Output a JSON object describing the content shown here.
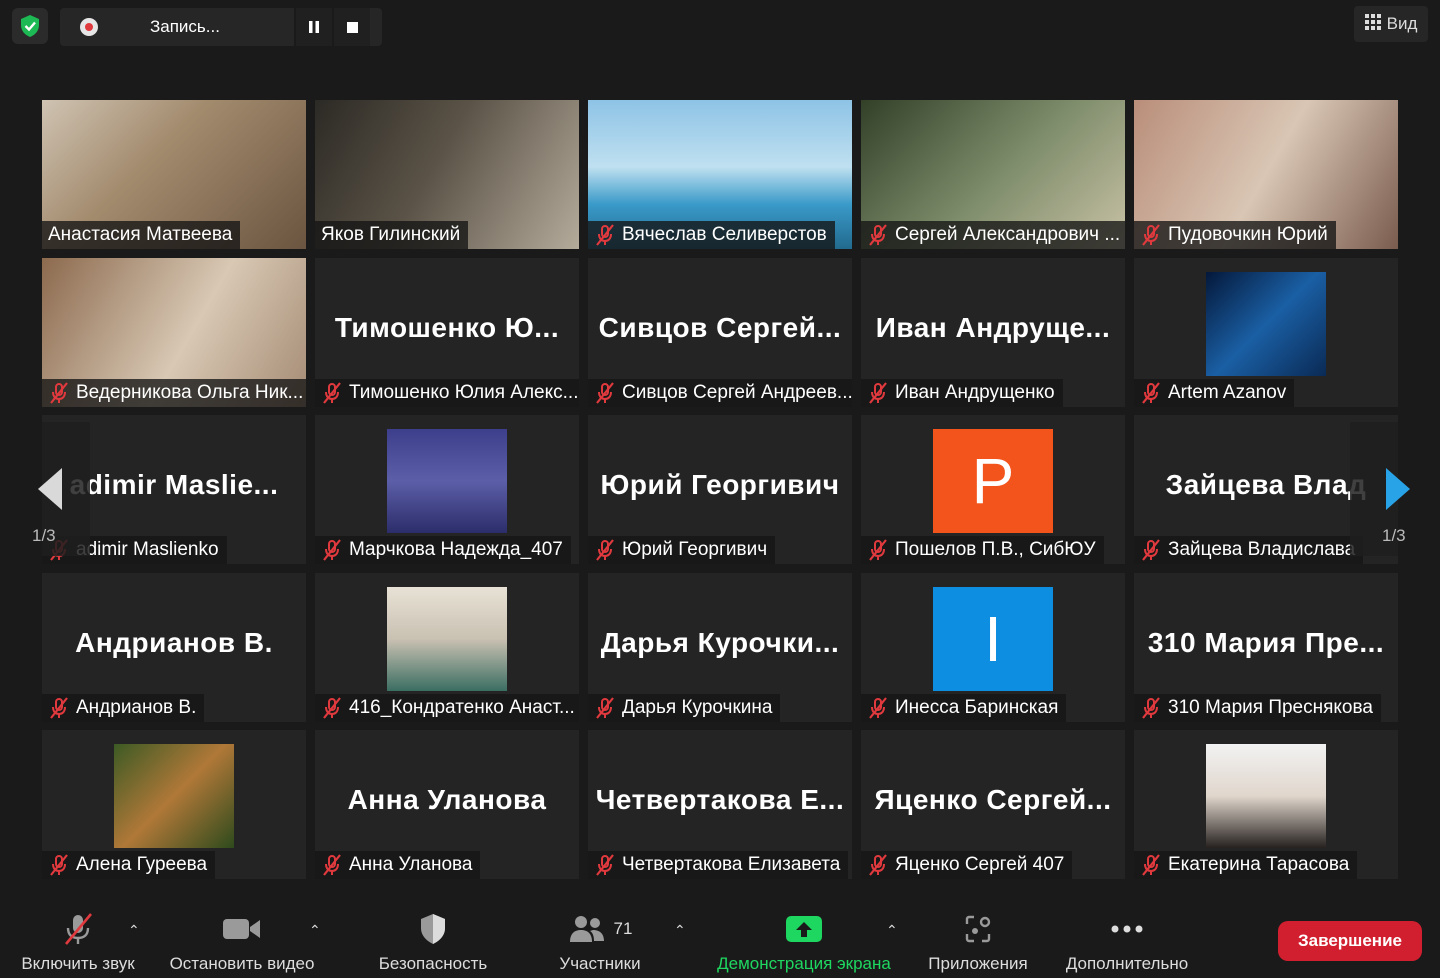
{
  "top_bar": {
    "recording_label": "Запись...",
    "view_label": "Вид"
  },
  "pagination": {
    "left": "1/3",
    "right": "1/3"
  },
  "participants": [
    {
      "label": "Анастасия Матвеева",
      "big": ""
    },
    {
      "label": "Яков Гилинский",
      "big": ""
    },
    {
      "label": "Вячеслав Селиверстов",
      "big": ""
    },
    {
      "label": "Сергей Александрович ...",
      "big": ""
    },
    {
      "label": "Пудовочкин Юрий",
      "big": ""
    },
    {
      "label": "Ведерникова Ольга Ник...",
      "big": ""
    },
    {
      "label": "Тимошенко Юлия Алекс...",
      "big": "Тимошенко  Ю..."
    },
    {
      "label": "Сивцов Сергей Андреев...",
      "big": "Сивцов  Сергей..."
    },
    {
      "label": "Иван Андрущенко",
      "big": "Иван  Андруще..."
    },
    {
      "label": "Artem Azanov",
      "big": ""
    },
    {
      "label": "adimir Maslienko",
      "big": "adimir  Maslie..."
    },
    {
      "label": "Марчкова Надежда_407",
      "big": ""
    },
    {
      "label": "Юрий Георгивич",
      "big": "Юрий Георгивич"
    },
    {
      "label": "Пошелов П.В., СибЮУ",
      "big": "",
      "avatar_letter": "P"
    },
    {
      "label": "Зайцева Владислава",
      "big": "Зайцева  Влад"
    },
    {
      "label": "Андрианов В.",
      "big": "Андрианов В."
    },
    {
      "label": "416_Кондратенко Анаст...",
      "big": ""
    },
    {
      "label": "Дарья Курочкина",
      "big": "Дарья  Курочки..."
    },
    {
      "label": "Инесса Баринская",
      "big": "",
      "avatar_letter": "I"
    },
    {
      "label": "310 Мария Преснякова",
      "big": "310  Мария  Пре..."
    },
    {
      "label": "Алена Гуреева",
      "big": ""
    },
    {
      "label": "Анна Уланова",
      "big": "Анна Уланова"
    },
    {
      "label": "Четвертакова Елизавета",
      "big": "Четвертакова  Е..."
    },
    {
      "label": "Яценко Сергей 407",
      "big": "Яценко  Сергей..."
    },
    {
      "label": "Екатерина Тарасова",
      "big": ""
    }
  ],
  "toolbar": {
    "unmute": "Включить звук",
    "stop_video": "Остановить видео",
    "security": "Безопасность",
    "participants": "Участники",
    "participants_count": "71",
    "share_screen": "Демонстрация экрана",
    "apps": "Приложения",
    "more": "Дополнительно",
    "end": "Завершение"
  },
  "colors": {
    "active_speaker": "#d8e84c",
    "share_green": "#1ed760",
    "end_red": "#d21f2f",
    "nav_arrow": "#29a3e8",
    "avatar_orange": "#f2541b",
    "avatar_blue": "#0e8ee0"
  }
}
